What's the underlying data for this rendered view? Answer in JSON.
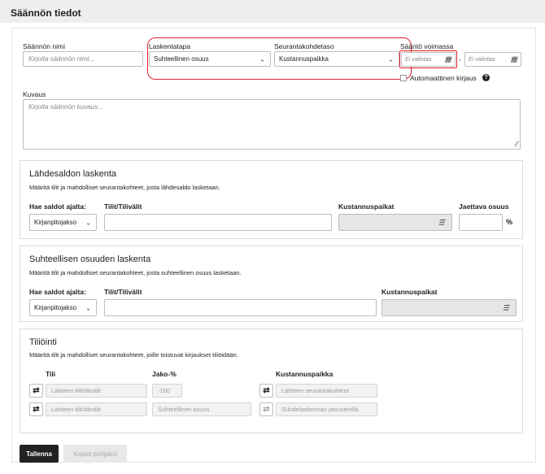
{
  "header": {
    "title": "Säännön tiedot"
  },
  "rule": {
    "name_label": "Säännön nimi",
    "name_placeholder": "Kirjoita säännön nimi...",
    "calc_method_label": "Laskentatapa",
    "calc_method_value": "Suhteellinen osuus",
    "tracking_level_label": "Seurantakohdetaso",
    "tracking_level_value": "Kustannuspaikka",
    "valid_label": "Sääntö voimassa",
    "valid_from_placeholder": "Ei valintaa",
    "valid_dash": "-",
    "valid_to_placeholder": "Ei valintaa",
    "auto_entry_label": "Automaattinen kirjaus",
    "description_label": "Kuvaus",
    "description_placeholder": "Kirjoita säännön kuvaus..."
  },
  "source_balance": {
    "title": "Lähdesaldon laskenta",
    "description": "Määritä tilit ja mahdolliset seurantakohteet, josta lähdesaldo lasketaan.",
    "fetch_label": "Hae saldot ajalta:",
    "fetch_value": "Kirjanpitojakso",
    "accounts_label": "Tilit/Tilivälit",
    "cost_centers_label": "Kustannuspaikat",
    "share_label": "Jaettava osuus",
    "share_unit": "%"
  },
  "relative_share": {
    "title": "Suhteellisen osuuden laskenta",
    "description": "Määritä tilit ja mahdolliset seurantakohteet, josta suhteellinen osuus lasketaan.",
    "fetch_label": "Hae saldot ajalta:",
    "fetch_value": "Kirjanpitojakso",
    "accounts_label": "Tilit/Tilivälit",
    "cost_centers_label": "Kustannuspaikat"
  },
  "posting": {
    "title": "Tiliöinti",
    "description": "Määritä tilit ja mahdolliset seurantakohteet, joille toistuvat kirjaukset tiliöidään.",
    "col_account": "Tili",
    "col_share": "Jako-%",
    "col_cost_center": "Kustannuspaikka",
    "rows": [
      {
        "account": "Lähteen tilit/tilivälit",
        "share": "-100",
        "cost_center": "Lähteen seurantakohteet"
      },
      {
        "account": "Lähteen tilit/tilivälit",
        "share": "Suhteellinen osuus",
        "cost_center": "Suhdelaskennan perusteella"
      }
    ]
  },
  "actions": {
    "save": "Tallenna",
    "copy_template": "Kopioi pohjaksi"
  },
  "colors": {
    "highlight": "#e0222a",
    "primary_button": "#222222"
  }
}
